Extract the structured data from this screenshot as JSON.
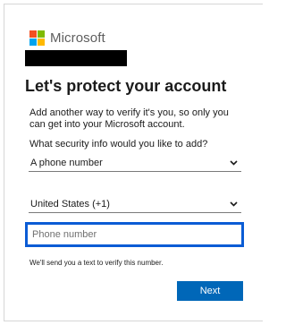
{
  "brand": {
    "name": "Microsoft",
    "logo_colors": [
      "#f25022",
      "#7fba00",
      "#00a4ef",
      "#ffb900"
    ]
  },
  "page": {
    "title": "Let's protect your account",
    "description": "Add another way to verify it's you, so only you can get into your Microsoft account.",
    "question": "What security info would you like to add?"
  },
  "form": {
    "method_select": {
      "value": "A phone number"
    },
    "country_select": {
      "value": "United States (+1)"
    },
    "phone_input": {
      "placeholder": "Phone number",
      "value": ""
    },
    "note": "We'll send you a text to verify this number.",
    "next_label": "Next"
  },
  "colors": {
    "accent": "#0067b8",
    "focus_border": "#0b5cd5",
    "redaction": "#000000"
  }
}
